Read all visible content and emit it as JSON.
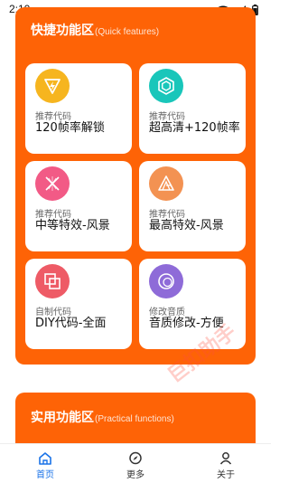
{
  "status_bar": {
    "time": "2:10"
  },
  "quick_features": {
    "title_cn": "快捷功能区",
    "title_en": "(Quick features)",
    "tiles": [
      {
        "icon": "lightning-icon",
        "color": "#F6B51F",
        "subtitle": "推荐代码",
        "title": "120帧率解锁"
      },
      {
        "icon": "hexagon-icon",
        "color": "#19C6BA",
        "subtitle": "推荐代码",
        "title": "超高清+120帧率"
      },
      {
        "icon": "sparkle-icon",
        "color": "#F25A86",
        "subtitle": "推荐代码",
        "title": "中等特效-风景"
      },
      {
        "icon": "triangle-icon",
        "color": "#F39252",
        "subtitle": "推荐代码",
        "title": "最高特效-风景"
      },
      {
        "icon": "squares-icon",
        "color": "#EE5B66",
        "subtitle": "自制代码",
        "title": "DIY代码-全面"
      },
      {
        "icon": "circle-icon",
        "color": "#8E6BD8",
        "subtitle": "修改音质",
        "title": "音质修改-方便"
      }
    ]
  },
  "practical_features": {
    "title_cn": "实用功能区",
    "title_en": "(Practical functions)"
  },
  "watermark": "巨扣助手",
  "bottom_nav": [
    {
      "label": "首页",
      "icon": "home-icon",
      "active": true
    },
    {
      "label": "更多",
      "icon": "compass-icon",
      "active": false
    },
    {
      "label": "关于",
      "icon": "person-icon",
      "active": false
    }
  ],
  "colors": {
    "primary": "#FE6306",
    "nav_active": "#1a73e8"
  }
}
